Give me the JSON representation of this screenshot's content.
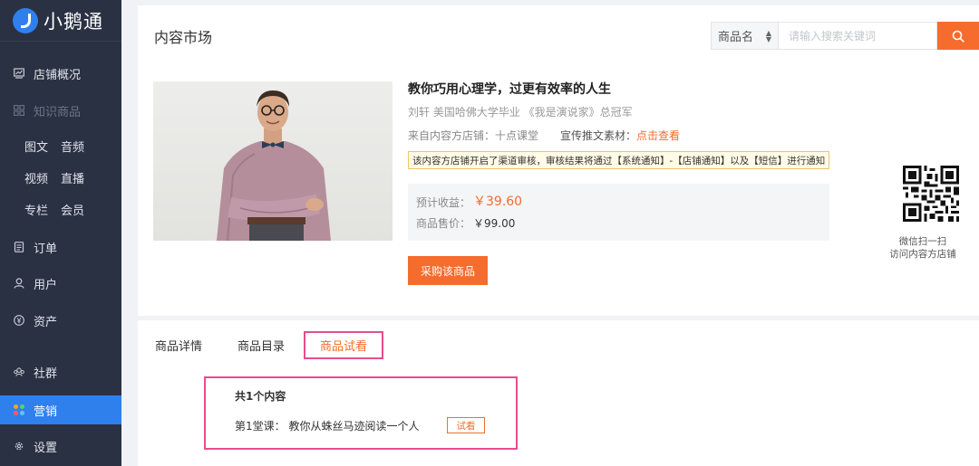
{
  "app": {
    "name": "小鹅通"
  },
  "sidebar": {
    "items": [
      {
        "label": "店铺概况",
        "icon": "chart-icon"
      },
      {
        "label": "知识商品",
        "icon": "grid-icon",
        "disabled": true
      },
      {
        "label": "订单",
        "icon": "document-icon"
      },
      {
        "label": "用户",
        "icon": "user-icon"
      },
      {
        "label": "资产",
        "icon": "yen-icon"
      },
      {
        "label": "社群",
        "icon": "community-icon"
      },
      {
        "label": "营销",
        "icon": "dots-icon",
        "active": true
      },
      {
        "label": "设置",
        "icon": "gear-icon"
      }
    ],
    "subitems": [
      [
        "图文",
        "音频"
      ],
      [
        "视频",
        "直播"
      ],
      [
        "专栏",
        "会员"
      ]
    ]
  },
  "header": {
    "title": "内容市场",
    "search": {
      "select_value": "商品名",
      "placeholder": "请输入搜索关键词"
    }
  },
  "product": {
    "title": "教你巧用心理学，过更有效率的人生",
    "author": "刘轩 美国哈佛大学毕业 《我是演说家》总冠军",
    "source": "来自内容方店铺：十点课堂",
    "promo_label": "宣传推文素材：",
    "promo_link": "点击查看",
    "notice": "该内容方店铺开启了渠道审核，审核结果将通过【系统通知】-【店铺通知】以及【短信】进行通知",
    "earnings_label": "预计收益：",
    "earnings_value": "￥39.60",
    "price_label": "商品售价：",
    "price_value": "￥99.00",
    "buy_label": "采购该商品"
  },
  "qr": {
    "caption_line1": "微信扫一扫",
    "caption_line2": "访问内容方店铺"
  },
  "tabs": [
    {
      "label": "商品详情"
    },
    {
      "label": "商品目录"
    },
    {
      "label": "商品试看",
      "active": true
    }
  ],
  "trial": {
    "count": "共1个内容",
    "lesson": "第1堂课：  教你从蛛丝马迹阅读一个人",
    "button": "试看"
  },
  "colors": {
    "accent": "#f56c2d",
    "sidebar_bg": "#2a3143",
    "active_nav": "#2f80ed",
    "highlight": "#e84c8e"
  }
}
